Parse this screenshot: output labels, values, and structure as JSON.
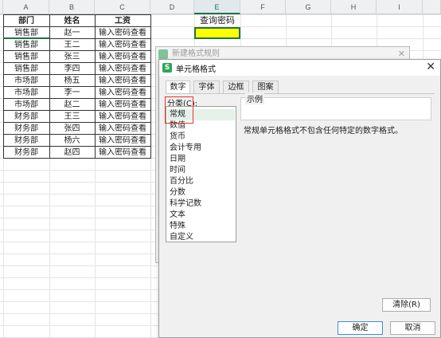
{
  "sheet": {
    "columns": [
      "A",
      "B",
      "C",
      "D",
      "E",
      "F",
      "G",
      "H",
      "I"
    ],
    "selected_column": "E",
    "table_headers": [
      "部门",
      "姓名",
      "工资"
    ],
    "rows": [
      [
        "销售部",
        "赵一",
        "输入密码查看"
      ],
      [
        "销售部",
        "王二",
        "输入密码查看"
      ],
      [
        "销售部",
        "张三",
        "输入密码查看"
      ],
      [
        "销售部",
        "李四",
        "输入密码查看"
      ],
      [
        "市场部",
        "杨五",
        "输入密码查看"
      ],
      [
        "市场部",
        "李一",
        "输入密码查看"
      ],
      [
        "市场部",
        "赵二",
        "输入密码查看"
      ],
      [
        "财务部",
        "王三",
        "输入密码查看"
      ],
      [
        "财务部",
        "张四",
        "输入密码查看"
      ],
      [
        "财务部",
        "杨六",
        "输入密码查看"
      ],
      [
        "财务部",
        "赵四",
        "输入密码查看"
      ]
    ],
    "e1_text": "查询密码",
    "highlight_color": "#ffff00",
    "accent_color": "#217346"
  },
  "back_dialog": {
    "title": "新建格式规则",
    "close_icon": "close-icon"
  },
  "dialog": {
    "title": "单元格格式",
    "logo_text": "S",
    "close_glyph": "✕",
    "tabs": [
      {
        "label": "数字",
        "active": true
      },
      {
        "label": "字体",
        "active": false
      },
      {
        "label": "边框",
        "active": false
      },
      {
        "label": "图案",
        "active": false
      }
    ],
    "category_label": "分类(C):",
    "categories": [
      "常规",
      "数值",
      "货币",
      "会计专用",
      "日期",
      "时间",
      "百分比",
      "分数",
      "科学记数",
      "文本",
      "特殊",
      "自定义"
    ],
    "selected_category": "常规",
    "sample_label": "示例",
    "description": "常规单元格格式不包含任何特定的数字格式。",
    "buttons": {
      "clear": "清除(R)",
      "ok": "确定",
      "cancel": "取消"
    }
  }
}
